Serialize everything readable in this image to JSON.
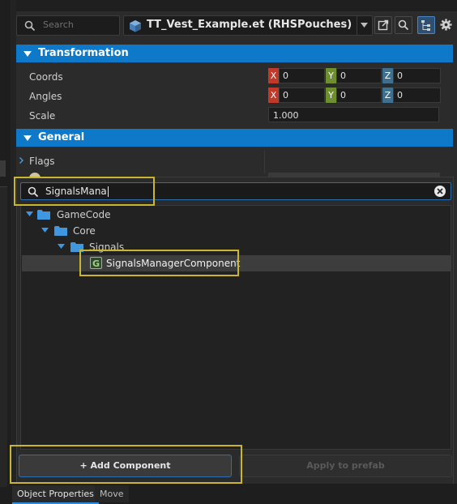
{
  "toolbar": {
    "search_placeholder": "Search",
    "entity_title": "TT_Vest_Example.et (RHSPouches)"
  },
  "transformation": {
    "title": "Transformation",
    "coords_label": "Coords",
    "angles_label": "Angles",
    "scale_label": "Scale",
    "axis_x": "X",
    "axis_y": "Y",
    "axis_z": "Z",
    "coords": {
      "x": "0",
      "y": "0",
      "z": "0"
    },
    "angles": {
      "x": "0",
      "y": "0",
      "z": "0"
    },
    "scale": "1.000"
  },
  "general": {
    "title": "General",
    "flags_label": "Flags"
  },
  "component_picker": {
    "search_value": "SignalsMana",
    "tree": [
      {
        "label": "GameCode",
        "level": 0,
        "expanded": true
      },
      {
        "label": "Core",
        "level": 1,
        "expanded": true
      },
      {
        "label": "Signals",
        "level": 2,
        "expanded": true
      },
      {
        "label": "SignalsManagerComponent",
        "level": 3,
        "icon": "G"
      }
    ]
  },
  "buttons": {
    "add_component": "+ Add Component",
    "apply_to_prefab": "Apply to prefab"
  },
  "tabs": {
    "object_properties": "Object Properties",
    "move": "Move"
  },
  "colors": {
    "accent": "#0e78c9",
    "highlight": "#c8b530",
    "axis_x": "#c0392b",
    "axis_y": "#6d8f2f",
    "axis_z": "#3f6f8f"
  }
}
